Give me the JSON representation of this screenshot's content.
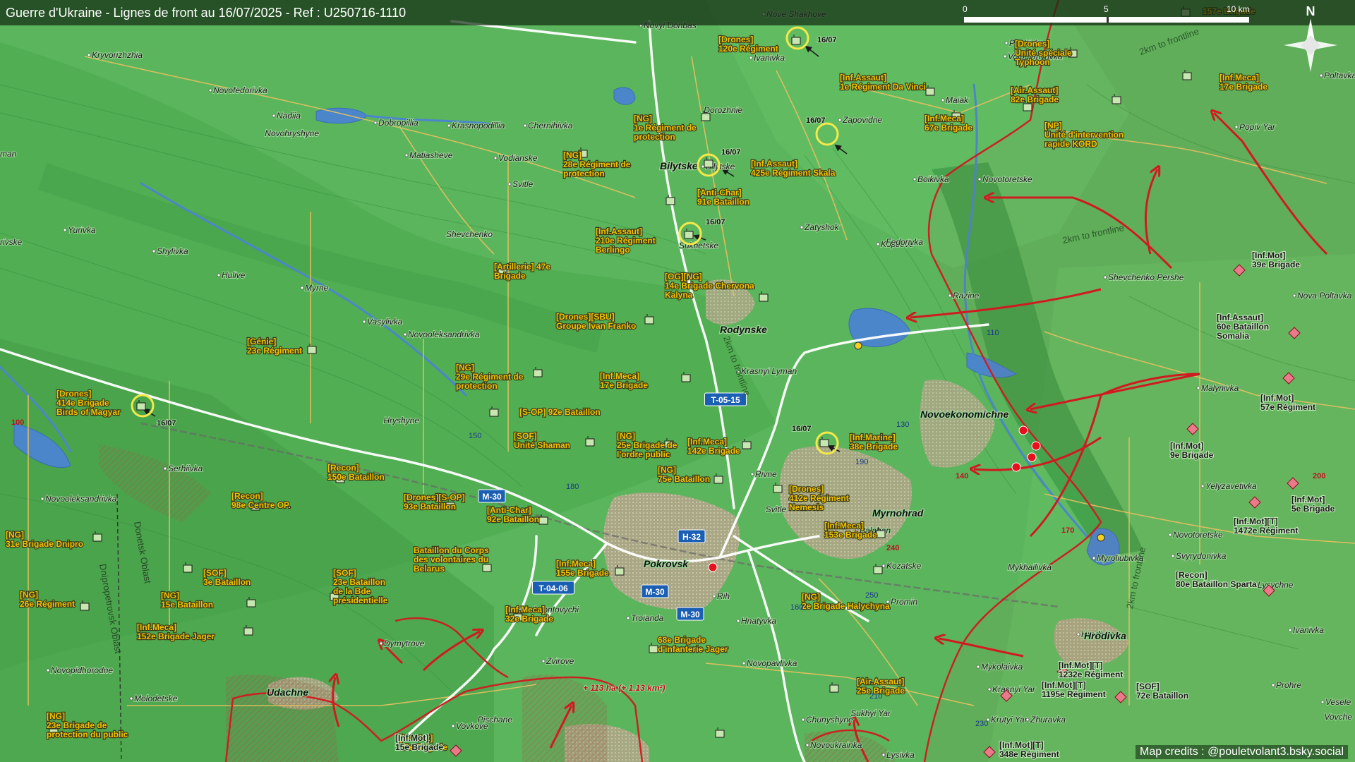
{
  "header": {
    "title": "Guerre d'Ukraine - Lignes de front au 16/07/2025 - Ref : U250716-1110",
    "scale": {
      "zero": "0",
      "mid": "5",
      "end": "10 km"
    },
    "north": "N"
  },
  "credits": "Map credits : @pouletvolant3.bsky.social",
  "places_small": [
    "Kryvorizhzhia",
    "Novofedorivka",
    "Nadiia",
    "Novohryshyne",
    "Dobropillia",
    "Krasnopodillia",
    "Chernihivka",
    "Vodianske",
    "Matiasheve",
    "Svitle",
    "Shevchenko",
    "Yurivka",
    "Shylivka",
    "Hulive",
    "Myrne",
    "Vasylivka",
    "Novooleksandrivka",
    "Hryshyne",
    "Serhiivka",
    "Novooleksandrivka",
    "Dymytrove",
    "Novopidhorodne",
    "Molodetske",
    "Vovkove",
    "Pischane",
    "Zvirove",
    "Leontovychi",
    "Troianda",
    "Hnatyvka",
    "Rih",
    "Rivne",
    "Svitle",
    "Balahan",
    "Kozatske",
    "Promin",
    "Novopavlivka",
    "Chunyshyne",
    "Novoukrainka",
    "Sukhyi Yar",
    "Lysivka",
    "Mykolaivka",
    "Krasnyi Yar",
    "Krutyi Yar",
    "Zhuravka",
    "Hrodivka",
    "Mykhailivka",
    "Myroliubivka",
    "Novotoretske",
    "Svyrydonivka",
    "Lysychne",
    "Ivanivka",
    "Veselе",
    "Vovche",
    "Yelyzavetivka",
    "Malynivka",
    "Nova Poltavka",
    "Razine",
    "Koptieve",
    "Shevchenko Pershe",
    "Fedorivka",
    "Boikivka",
    "Novotoretske",
    "Pankivka",
    "Volodymyrivka",
    "Maiak",
    "Zapovidne",
    "Dorozhnie",
    "Ivanivka",
    "Novyi Donbas",
    "Nove Shakhove",
    "Poltavka",
    "Popiv Yar",
    "Zatyshok",
    "Sukhetske",
    "Krasnyi Lyman",
    "Bilytske",
    "Prohre",
    "rivske",
    "man"
  ],
  "places_big": [
    "Pokrovsk",
    "Rodynske",
    "Novoekonomichne",
    "Myrnohrad",
    "Udachne",
    "Hrodivka",
    "Bilytske"
  ],
  "units": [
    {
      "label": "[Drones]\n120e Régiment"
    },
    {
      "label": "[Inf.Assaut]\n1e Régiment Da Vinci"
    },
    {
      "label": "[Inf.Meca]\n67e Brigade"
    },
    {
      "label": "[Drones]\nUnité spéciale\nTyphoon"
    },
    {
      "label": "[Air.Assaut]\n82e Brigade"
    },
    {
      "label": "[NP]\nUnité d'intervention\nrapide KORD"
    },
    {
      "label": "[Inf.Meca]\n17e Brigade"
    },
    {
      "label": "157e Brigade"
    },
    {
      "label": "[NG]\n1e Régiment de\nprotection"
    },
    {
      "label": "[NG]\n28e Régiment de\nprotection"
    },
    {
      "label": "[Inf.Assaut]\n425e Régiment Skala"
    },
    {
      "label": "[Anti-Char]\n91e Bataillon"
    },
    {
      "label": "[Inf.Assaut]\n210e Régiment\nBerlingo"
    },
    {
      "label": "[Artillerie] 47e\nBrigade"
    },
    {
      "label": "[OG][NG]\n14e Brigade Chervona\nKalyna"
    },
    {
      "label": "[Drones][SBU]\nGroupe Ivan Franko"
    },
    {
      "label": "[Génie]\n23e Régiment"
    },
    {
      "label": "[NG]\n29e Régiment de\nprotection"
    },
    {
      "label": "[Inf.Meca]\n17e Brigade"
    },
    {
      "label": "[Drones]\n414e Brigade\nBirds of Magyar"
    },
    {
      "label": "[S-OP] 92e Bataillon"
    },
    {
      "label": "[SOF]\nUnité Shaman"
    },
    {
      "label": "[NG]\n25e Brigade de\nl'ordre public"
    },
    {
      "label": "[Inf.Meca]\n142e Brigade"
    },
    {
      "label": "[Inf.Marine]\n38e Brigade"
    },
    {
      "label": "[Recon]\n150e Bataillon"
    },
    {
      "label": "[NG]\n75e Bataillon"
    },
    {
      "label": "[Drones]\n412e Régiment\nNemesis"
    },
    {
      "label": "[Recon]\n98e Centre OP."
    },
    {
      "label": "[Drones][S-OP]\n93e Bataillon"
    },
    {
      "label": "[Anti-Char]\n92e Bataillon"
    },
    {
      "label": "[Inf.Meca]\n153e Brigade"
    },
    {
      "label": "[NG]\n31e Brigade Dnipro"
    },
    {
      "label": "[SOF]\n3e Bataillon"
    },
    {
      "label": "Bataillon du Corps\ndes volontaires du\nBelarus"
    },
    {
      "label": "[Inf.Meca]\n155e Brigade"
    },
    {
      "label": "[NG]\n26e Régiment"
    },
    {
      "label": "[NG]\n15e Bataillon"
    },
    {
      "label": "[SOF]\n23e Bataillon\nde la Bde\nprésidentielle"
    },
    {
      "label": "[Inf.Meca]\n152e Brigade Jager"
    },
    {
      "label": "[Inf.Meca]\n32e Brigade"
    },
    {
      "label": "68e Brigade\nd'infanterie Jager"
    },
    {
      "label": "[NG]\n2e Brigade Halychyna"
    },
    {
      "label": "[Air.Assaut]\n25e Brigade"
    },
    {
      "label": "[NG]\n23e Brigade de\nprotection du public"
    },
    {
      "label": "[Inf.Mot]\n15e Brigade"
    }
  ],
  "enemy_units": [
    {
      "label": "[Inf.Mot]\n39e Brigade"
    },
    {
      "label": "[Inf.Assaut]\n60e Bataillon\nSomalia"
    },
    {
      "label": "[Inf.Mot]\n57e Régiment"
    },
    {
      "label": "[Inf.Mot]\n9e Brigade"
    },
    {
      "label": "[Inf.Mot]\n5e Brigade"
    },
    {
      "label": "[Inf.Mot][T]\n1472e Régiment"
    },
    {
      "label": "[Recon]\n80e Bataillon Sparta"
    },
    {
      "label": "[Inf.Mot][T]\n1232e Régiment"
    },
    {
      "label": "[Inf.Mot][T]\n1195e Régiment"
    },
    {
      "label": "[SOF]\n72e Bataillon"
    },
    {
      "label": "[Inf.Mot][T]\n348e Régiment"
    },
    {
      "label": "[Inf.Mot]\n15e Brigade"
    }
  ],
  "roads": [
    "T-05-15",
    "M-30",
    "H-32",
    "M-30",
    "M-30",
    "T-04-06"
  ],
  "dates": [
    "16/07"
  ],
  "frontline_note": "2km to frontline",
  "gain_note": "+ 113 ha (+ 1.13 km²)",
  "oblast_labels": [
    "Donetsk Oblast",
    "Dnipropetrovsk Oblast"
  ],
  "elevations": [
    "100",
    "110",
    "130",
    "140",
    "150",
    "160",
    "170",
    "180",
    "190",
    "200",
    "210",
    "230",
    "240",
    "250"
  ],
  "colors": {
    "terrain": "#59b35a",
    "friendly": "#f2c200",
    "enemy": "#e0202a",
    "road": "#ffffff",
    "road_sign": "#1a5fb4",
    "water": "#4a86c9"
  }
}
